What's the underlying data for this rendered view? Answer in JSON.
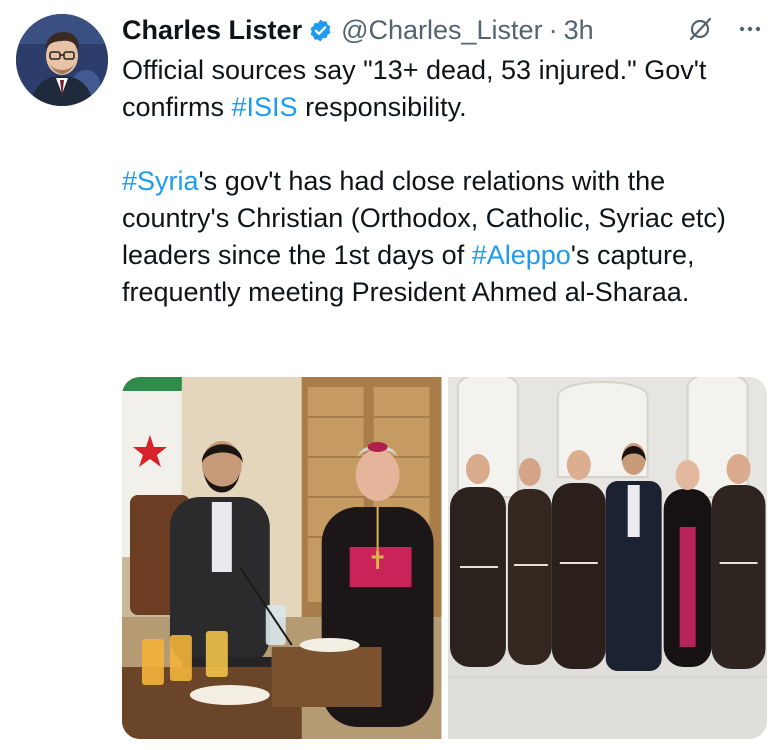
{
  "tweet": {
    "author": {
      "name": "Charles Lister",
      "handle": "@Charles_Lister",
      "verified": true
    },
    "separator": "·",
    "time": "3h",
    "paragraphs": [
      {
        "segments": [
          {
            "text": "Official sources say \"13+ dead, 53 injured.\" Gov't confirms ",
            "hashtag": false
          },
          {
            "text": "#ISIS",
            "hashtag": true
          },
          {
            "text": " responsibility.",
            "hashtag": false
          }
        ]
      },
      {
        "segments": [
          {
            "text": "#Syria",
            "hashtag": true
          },
          {
            "text": "'s gov't has had close relations with the country's Christian (Orthodox, Catholic, Syriac etc) leaders since the 1st days of ",
            "hashtag": false
          },
          {
            "text": "#Aleppo",
            "hashtag": true
          },
          {
            "text": "'s capture, frequently meeting President Ahmed al-Sharaa.",
            "hashtag": false
          }
        ]
      }
    ],
    "media": [
      {
        "icon": "photo-meeting-seated"
      },
      {
        "icon": "photo-group-standing"
      }
    ]
  },
  "icons": {
    "verified": "verified-badge-icon",
    "grok": "grok-icon",
    "more": "more-icon"
  },
  "colors": {
    "text": "#0f1419",
    "muted": "#536471",
    "link": "#1d9bf0",
    "verified": "#1d9bf0"
  }
}
